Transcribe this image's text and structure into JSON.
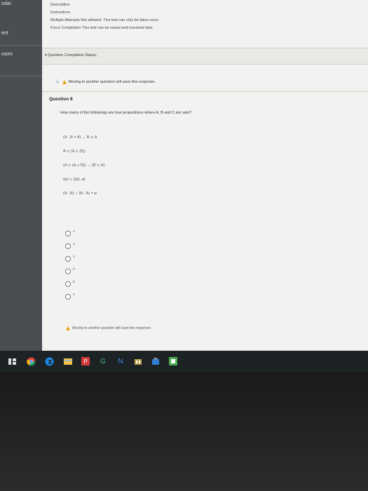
{
  "sidebar": {
    "items": [
      {
        "label": "ndar"
      },
      {
        "label": "ent"
      },
      {
        "label": "room"
      }
    ]
  },
  "top_info": {
    "description": "Description",
    "instructions": "Instructions",
    "multiple_attempts": "Multiple Attempts  Not allowed. This test can only be taken once.",
    "force_completion": "Force Completion  This test can be saved and resumed later."
  },
  "completion_status": "▾ Question Completion Status:",
  "warning_top": "Moving to another question will save this response.",
  "question": {
    "label": "Question 8",
    "text": "How many of the followings are true propositions where A, B and C are sets?",
    "propositions": [
      "(A - B = A) → B ⊂ A",
      "A ⊂ (A ∪ {5})",
      "(A ⊂ (A ∪ B)) → (B ⊂ A)",
      "{ø} ⊂ {{ø}, ø}",
      "(A - B) ∩ (B - A) = ø"
    ],
    "options": [
      "2",
      "3",
      "1",
      "0",
      "5",
      "4"
    ]
  },
  "warning_bottom": "Moving to another question will save this response.",
  "taskbar_icons": [
    "task-view-icon",
    "chrome-icon",
    "edge-icon",
    "file-explorer-icon",
    "word-icon",
    "g-icon",
    "n-icon",
    "app-icon",
    "store-icon",
    "green-app-icon"
  ],
  "colors": {
    "sidebar": "#4a4e52",
    "content": "#f2f3f1",
    "warning": "#e8a317",
    "taskbar": "#1d2225"
  }
}
